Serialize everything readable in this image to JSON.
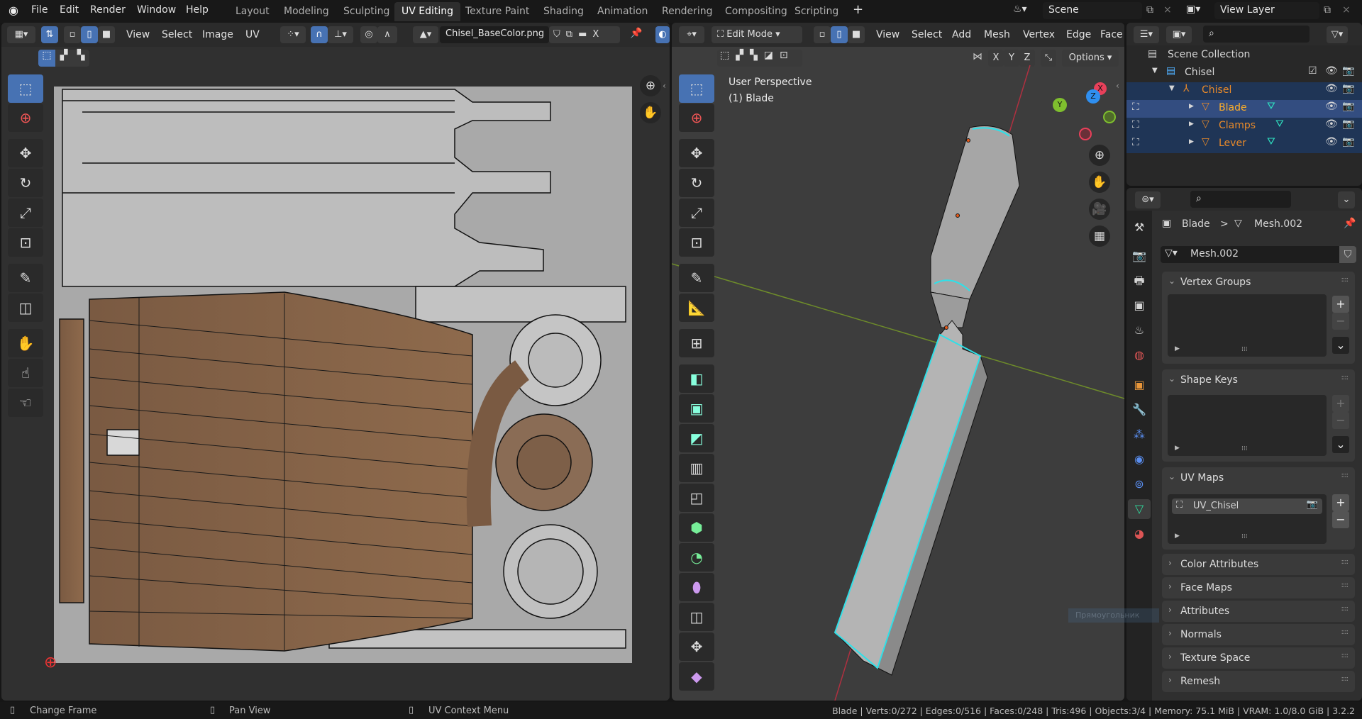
{
  "topbar": {
    "menus": [
      "File",
      "Edit",
      "Render",
      "Window",
      "Help"
    ],
    "workspaces": [
      "Layout",
      "Modeling",
      "Sculpting",
      "UV Editing",
      "Texture Paint",
      "Shading",
      "Animation",
      "Rendering",
      "Compositing",
      "Scripting"
    ],
    "active_workspace": "UV Editing",
    "add_tab": "+",
    "scene": "Scene",
    "view_layer": "View Layer",
    "close": "×"
  },
  "uv_editor": {
    "menus": [
      "View",
      "Select",
      "Image",
      "UV"
    ],
    "image_name": "Chisel_BaseColor.png",
    "close": "X"
  },
  "viewport": {
    "mode": "Edit Mode",
    "menus": [
      "View",
      "Select",
      "Add",
      "Mesh",
      "Vertex",
      "Edge",
      "Face"
    ],
    "axes": [
      "X",
      "Y",
      "Z"
    ],
    "options": "Options",
    "perspective": "User Perspective",
    "object_label": "(1) Blade",
    "gizmo": {
      "x": "X",
      "y": "Y",
      "z": "Z"
    },
    "colors": {
      "x": "#e8405a",
      "y": "#7fbf2e",
      "z": "#2f8ff0",
      "selected_edge": "#2fe0e8"
    }
  },
  "outliner": {
    "root": "Scene Collection",
    "items": [
      {
        "name": "Chisel",
        "type": "collection"
      },
      {
        "name": "Chisel",
        "type": "empty"
      },
      {
        "name": "Blade",
        "type": "mesh",
        "active": true
      },
      {
        "name": "Clamps",
        "type": "mesh"
      },
      {
        "name": "Lever",
        "type": "mesh"
      }
    ]
  },
  "properties": {
    "breadcrumb_object": "Blade",
    "breadcrumb_sep": ">",
    "breadcrumb_data": "Mesh.002",
    "mesh_name": "Mesh.002",
    "panels": {
      "vertex_groups": "Vertex Groups",
      "shape_keys": "Shape Keys",
      "uv_maps": "UV Maps",
      "color_attributes": "Color Attributes",
      "face_maps": "Face Maps",
      "attributes": "Attributes",
      "normals": "Normals",
      "texture_space": "Texture Space",
      "remesh": "Remesh"
    },
    "uv_map_item": "UV_Chisel",
    "plus": "+",
    "minus": "−"
  },
  "tooltip_ghost": "Прямоугольник",
  "statusbar": {
    "hints": [
      "Change Frame",
      "Pan View",
      "UV Context Menu"
    ],
    "stats": "Blade | Verts:0/272 | Edges:0/516 | Faces:0/248 | Tris:496 | Objects:3/4 | Memory: 75.1 MiB | VRAM: 1.0/8.0 GiB | 3.2.2"
  }
}
